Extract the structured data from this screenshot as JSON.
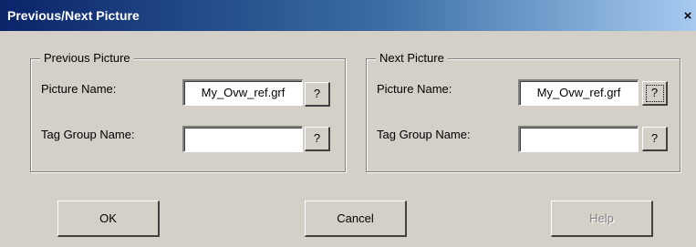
{
  "window": {
    "title": "Previous/Next Picture",
    "close_glyph": "×"
  },
  "previous": {
    "legend": "Previous Picture",
    "picture_name_label": "Picture Name:",
    "picture_name_value": "My_Ovw_ref.grf",
    "tag_group_label": "Tag Group Name:",
    "tag_group_value": "",
    "browse_label": "?"
  },
  "next": {
    "legend": "Next Picture",
    "picture_name_label": "Picture Name:",
    "picture_name_value": "My_Ovw_ref.grf",
    "tag_group_label": "Tag Group Name:",
    "tag_group_value": "",
    "browse_label": "?"
  },
  "buttons": {
    "ok": "OK",
    "cancel": "Cancel",
    "help": "Help"
  },
  "colors": {
    "dialog_bg": "#d4d0c8",
    "title_start": "#0a246a",
    "title_end": "#a6caf0"
  }
}
